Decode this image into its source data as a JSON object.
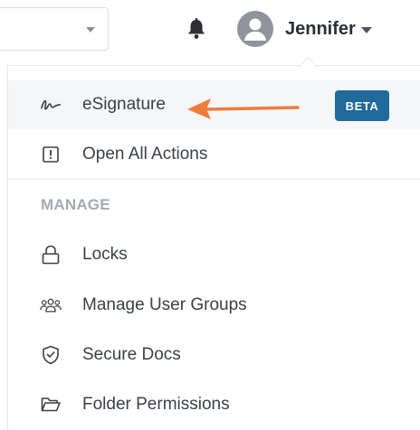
{
  "header": {
    "user_name": "Jennifer",
    "icons": {
      "select_caret": "chevron-down-icon",
      "bell": "bell-icon",
      "avatar": "user-avatar-icon",
      "user_caret": "caret-down-icon"
    }
  },
  "menu": {
    "items_top": [
      {
        "label": "eSignature",
        "icon": "signature-icon",
        "badge": "BETA"
      },
      {
        "label": "Open All Actions",
        "icon": "exclamation-square-icon"
      }
    ],
    "section_label": "MANAGE",
    "items_manage": [
      {
        "label": "Locks",
        "icon": "lock-icon"
      },
      {
        "label": "Manage User Groups",
        "icon": "users-group-icon"
      },
      {
        "label": "Secure Docs",
        "icon": "shield-check-icon"
      },
      {
        "label": "Folder Permissions",
        "icon": "folder-open-icon"
      }
    ]
  },
  "colors": {
    "badge_bg": "#1d6a9b",
    "arrow": "#f07c3c",
    "highlight_bg": "#f4f6f8",
    "text": "#3b4048",
    "section": "#a4a9b1"
  }
}
